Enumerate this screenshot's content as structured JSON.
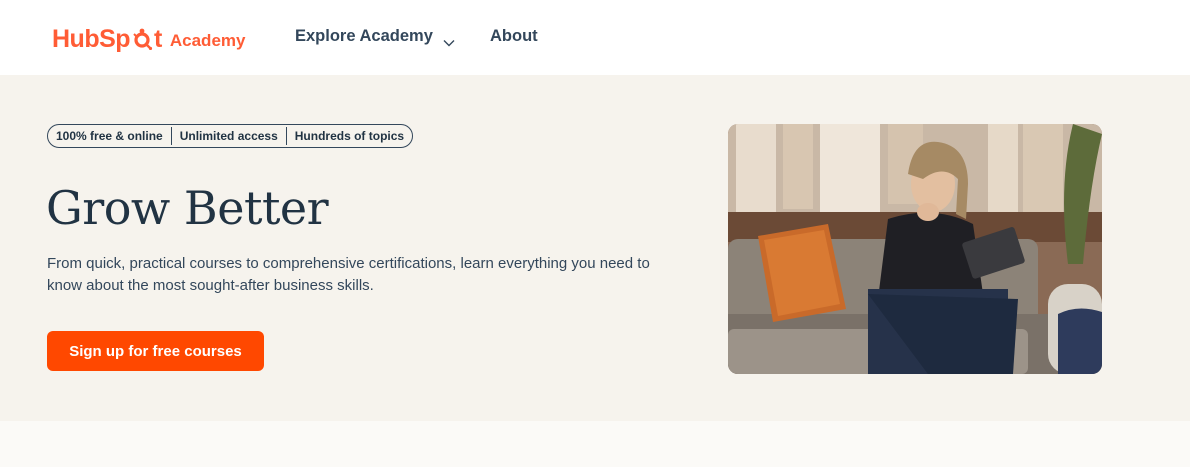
{
  "brand": {
    "name_part1": "HubSp",
    "name_part2": "t",
    "sub": "Academy",
    "color": "#ff5c35"
  },
  "nav": {
    "items": [
      {
        "label": "Explore Academy",
        "has_dropdown": true
      },
      {
        "label": "About",
        "has_dropdown": false
      }
    ]
  },
  "hero": {
    "badges": [
      "100% free & online",
      "Unlimited access",
      "Hundreds of topics"
    ],
    "headline": "Grow Better",
    "description": "From quick, practical courses to comprehensive certifications, learn everything you need to know about the most sought-after business skills.",
    "cta_label": "Sign up for free courses",
    "cta_color": "#ff4800",
    "background": "#f6f3ed"
  },
  "colors": {
    "text_dark": "#213343",
    "text_body": "#33475b"
  },
  "icons": {
    "dropdown": "chevron-down-icon",
    "logo_sprocket": "sprocket-icon"
  }
}
